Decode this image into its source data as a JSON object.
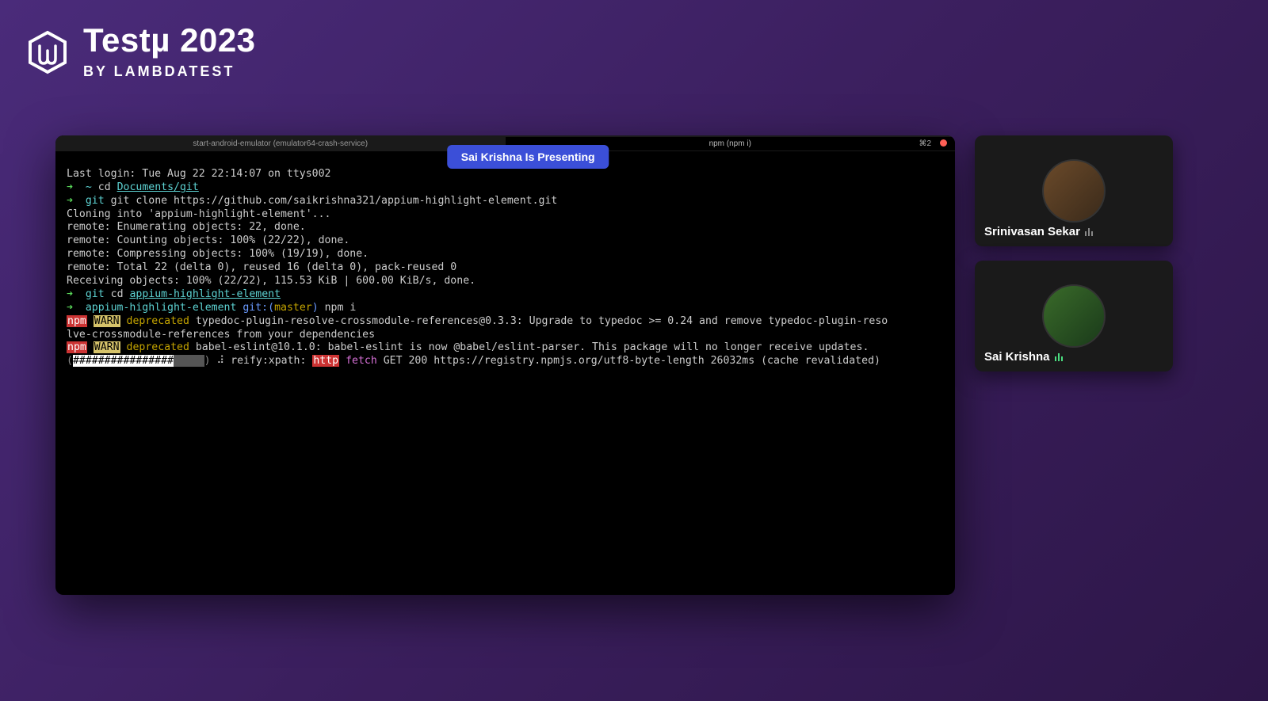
{
  "brand": {
    "title": "Testµ 2023",
    "subtitle": "BY LAMBDATEST"
  },
  "presenter_badge": "Sai Krishna Is Presenting",
  "terminal": {
    "tab_left": "start-android-emulator (emulator64-crash-service)",
    "tab_right": "npm (npm i)",
    "shortcut": "⌘2",
    "last_login": "Last login: Tue Aug 22 22:14:07 on ttys002",
    "cd_home_prefix": "~",
    "cd_home_cmd": "cd",
    "cd_home_path": "Documents/git",
    "git_prompt": "git",
    "git_clone": "git clone https://github.com/saikrishna321/appium-highlight-element.git",
    "cloning": "Cloning into 'appium-highlight-element'...",
    "enum": "remote: Enumerating objects: 22, done.",
    "counting": "remote: Counting objects: 100% (22/22), done.",
    "compressing": "remote: Compressing objects: 100% (19/19), done.",
    "total": "remote: Total 22 (delta 0), reused 16 (delta 0), pack-reused 0",
    "receiving": "Receiving objects: 100% (22/22), 115.53 KiB | 600.00 KiB/s, done.",
    "cd_repo_cmd": "cd",
    "cd_repo_path": "appium-highlight-element",
    "repo_prompt": "appium-highlight-element",
    "git_branch": "git:(",
    "branch": "master",
    "branch_close": ")",
    "npm_cmd": "npm i",
    "npm_label": "npm",
    "warn_label": "WARN",
    "deprecated": "deprecated",
    "dep1": " typedoc-plugin-resolve-crossmodule-references@0.3.3: Upgrade to typedoc >= 0.24 and remove typedoc-plugin-reso",
    "dep1b": "lve-crossmodule-references from your dependencies",
    "dep2": " babel-eslint@10.1.0: babel-eslint is now @babel/eslint-parser. This package will no longer receive updates.",
    "progress_hash": "################",
    "progress_dots": "⠂⠂⠂⠂",
    "reify": " ⠼ reify:xpath: ",
    "http_label": "http",
    "fetch": "fetch",
    "fetch_rest": " GET 200 https://registry.npmjs.org/utf8-byte-length 26032ms (cache revalidated)"
  },
  "participants": {
    "p1": "Srinivasan Sekar",
    "p2": "Sai Krishna"
  }
}
